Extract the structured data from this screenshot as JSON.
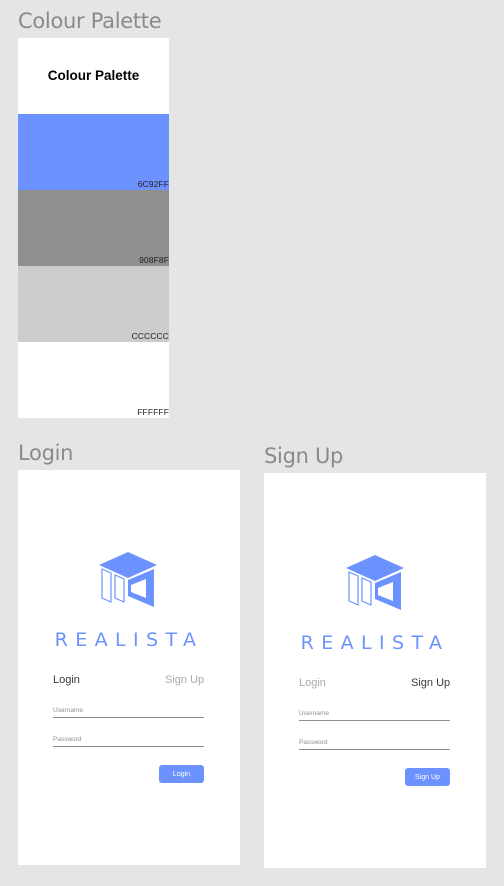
{
  "palette": {
    "frame_title": "Colour Palette",
    "card_heading": "Colour Palette",
    "swatches": [
      {
        "code": "6C92FF",
        "color": "#6c92ff"
      },
      {
        "code": "908F8F",
        "color": "#908f8f"
      },
      {
        "code": "CCCCCC",
        "color": "#cccccc"
      },
      {
        "code": "FFFFFF",
        "color": "#ffffff"
      }
    ]
  },
  "login": {
    "frame_title": "Login",
    "brand": "REALISTA",
    "tabs": {
      "login": "Login",
      "signup": "Sign Up"
    },
    "active_tab": "login",
    "username_placeholder": "Username",
    "password_placeholder": "Password",
    "button_label": "Login"
  },
  "signup": {
    "frame_title": "Sign Up",
    "brand": "REALISTA",
    "tabs": {
      "login": "Login",
      "signup": "Sign Up"
    },
    "active_tab": "signup",
    "username_placeholder": "Username",
    "password_placeholder": "Password",
    "button_label": "Sign Up"
  },
  "colors": {
    "accent": "#6c92ff",
    "tab_active": "#3a3a3a",
    "tab_inactive": "#a8a8a8"
  }
}
